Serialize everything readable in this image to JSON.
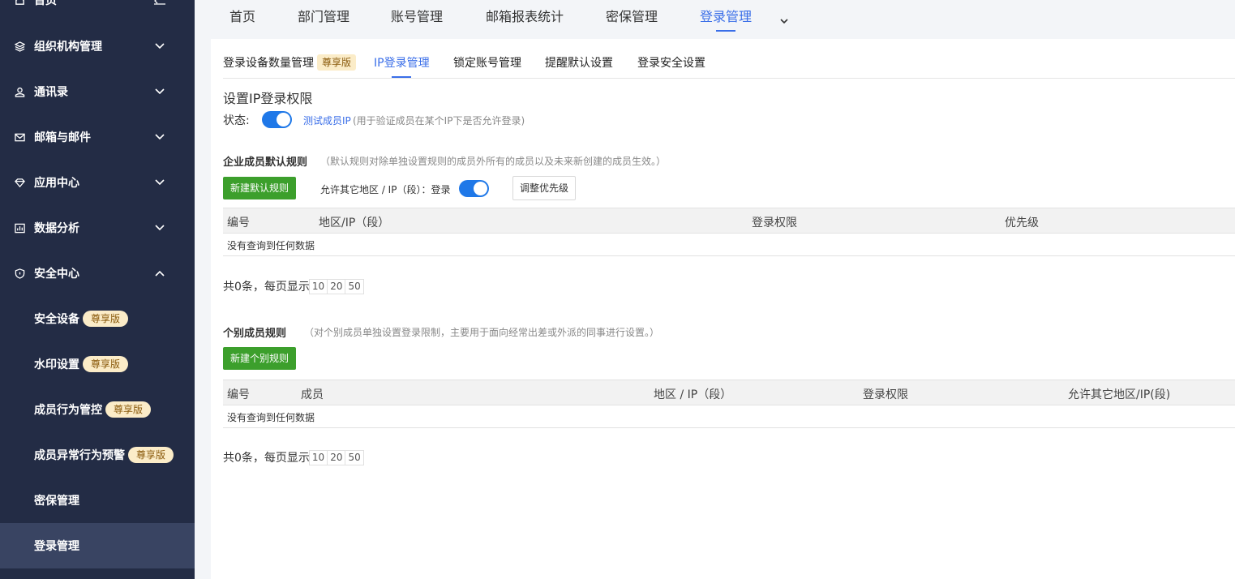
{
  "sidebar": {
    "items": [
      {
        "label": "首页"
      },
      {
        "label": "组织机构管理"
      },
      {
        "label": "通讯录"
      },
      {
        "label": "邮箱与邮件"
      },
      {
        "label": "应用中心"
      },
      {
        "label": "数据分析"
      },
      {
        "label": "安全中心"
      }
    ],
    "sub_items": [
      {
        "label": "安全设备",
        "badge": "尊享版"
      },
      {
        "label": "水印设置",
        "badge": "尊享版"
      },
      {
        "label": "成员行为管控",
        "badge": "尊享版"
      },
      {
        "label": "成员异常行为预警",
        "badge": "尊享版"
      },
      {
        "label": "密保管理"
      },
      {
        "label": "登录管理"
      }
    ]
  },
  "topnav": {
    "tabs": [
      {
        "label": "首页"
      },
      {
        "label": "部门管理"
      },
      {
        "label": "账号管理"
      },
      {
        "label": "邮箱报表统计"
      },
      {
        "label": "密保管理"
      },
      {
        "label": "登录管理"
      }
    ]
  },
  "subtabs": [
    {
      "label": "登录设备数量管理",
      "badge": "尊享版"
    },
    {
      "label": "IP登录管理"
    },
    {
      "label": "锁定账号管理"
    },
    {
      "label": "提醒默认设置"
    },
    {
      "label": "登录安全设置"
    }
  ],
  "section_title": "设置IP登录权限",
  "status": {
    "label": "状态:",
    "test_link": "测试成员IP",
    "hint": "(用于验证成员在某个IP下是否允许登录)"
  },
  "default_rules": {
    "title": "企业成员默认规则",
    "desc": "（默认规则对除单独设置规则的成员外所有的成员以及未来新创建的成员生效。）",
    "new_button": "新建默认规则",
    "allow_label": "允许其它地区 / IP（段）：登录",
    "priority_button": "调整优先级",
    "columns": [
      "编号",
      "地区/IP（段）",
      "登录权限",
      "优先级"
    ],
    "empty": "没有查询到任何数据",
    "pager": {
      "summary": "共0条，每页显示",
      "sizes": [
        "10",
        "20",
        "50"
      ]
    }
  },
  "member_rules": {
    "title": "个别成员规则",
    "desc": "（对个别成员单独设置登录限制，主要用于面向经常出差或外派的同事进行设置。）",
    "new_button": "新建个别规则",
    "columns": [
      "编号",
      "成员",
      "地区 / IP（段）",
      "登录权限",
      "允许其它地区/IP(段)"
    ],
    "empty": "没有查询到任何数据",
    "pager": {
      "summary": "共0条，每页显示",
      "sizes": [
        "10",
        "20",
        "50"
      ]
    }
  },
  "colors": {
    "sidebar_bg": "#232c45",
    "accent_blue": "#3a6ee8",
    "toggle_blue": "#1f78e8",
    "button_green": "#3c9f2c",
    "badge_bg": "#fbecc8"
  }
}
